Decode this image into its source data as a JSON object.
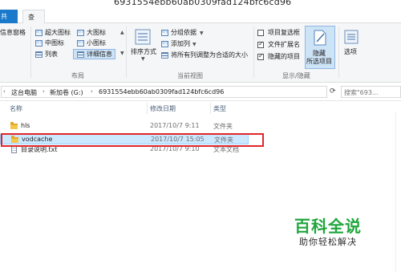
{
  "window": {
    "title": "6931554ebb60ab0309fad124bfc6cd96"
  },
  "tabs": {
    "share": "共享",
    "view": "查看"
  },
  "ribbon": {
    "panes": {
      "details_pane": "信息窗格"
    },
    "layout": {
      "extra_large": "超大图标",
      "large": "大图标",
      "medium": "中图标",
      "small": "小图标",
      "list": "列表",
      "details": "详细信息",
      "group_label": "布局"
    },
    "current_view": {
      "sort_by": "排序方式",
      "group_by": "分组依据",
      "add_column": "添加列",
      "size_all_columns": "将所有列调整为合适的大小",
      "group_label": "当前视图"
    },
    "show_hide": {
      "item_checkboxes": "项目复选框",
      "file_extensions": "文件扩展名",
      "hidden_items": "隐藏的项目",
      "item_checkboxes_checked": false,
      "file_extensions_checked": true,
      "hidden_items_checked": true,
      "hide_selected_line1": "隐藏",
      "hide_selected_line2": "所选项目",
      "group_label": "显示/隐藏"
    },
    "options": "选项"
  },
  "address": {
    "breadcrumbs": [
      "这台电脑",
      "新加卷 (G:)",
      "6931554ebb60ab0309fad124bfc6cd96"
    ],
    "search_placeholder": "搜索\"693..."
  },
  "columns": {
    "name": "名称",
    "modified": "修改日期",
    "type": "类型"
  },
  "files": [
    {
      "name": "hls",
      "modified": "2017/10/7 9:11",
      "type": "文件夹",
      "kind": "folder"
    },
    {
      "name": "vodcache",
      "modified": "2017/10/7 15:05",
      "type": "文件夹",
      "kind": "folder",
      "selected": true
    },
    {
      "name": "目录说明.txt",
      "modified": "2017/10/7 9:10",
      "type": "文本文档",
      "kind": "text"
    }
  ],
  "watermark": {
    "brand": "百科全说",
    "tagline": "助你轻松解决"
  },
  "colors": {
    "accent": "#1979ca",
    "selection": "#cce8ff",
    "highlight_box": "#e0262a",
    "watermark": "#1fa63c"
  }
}
